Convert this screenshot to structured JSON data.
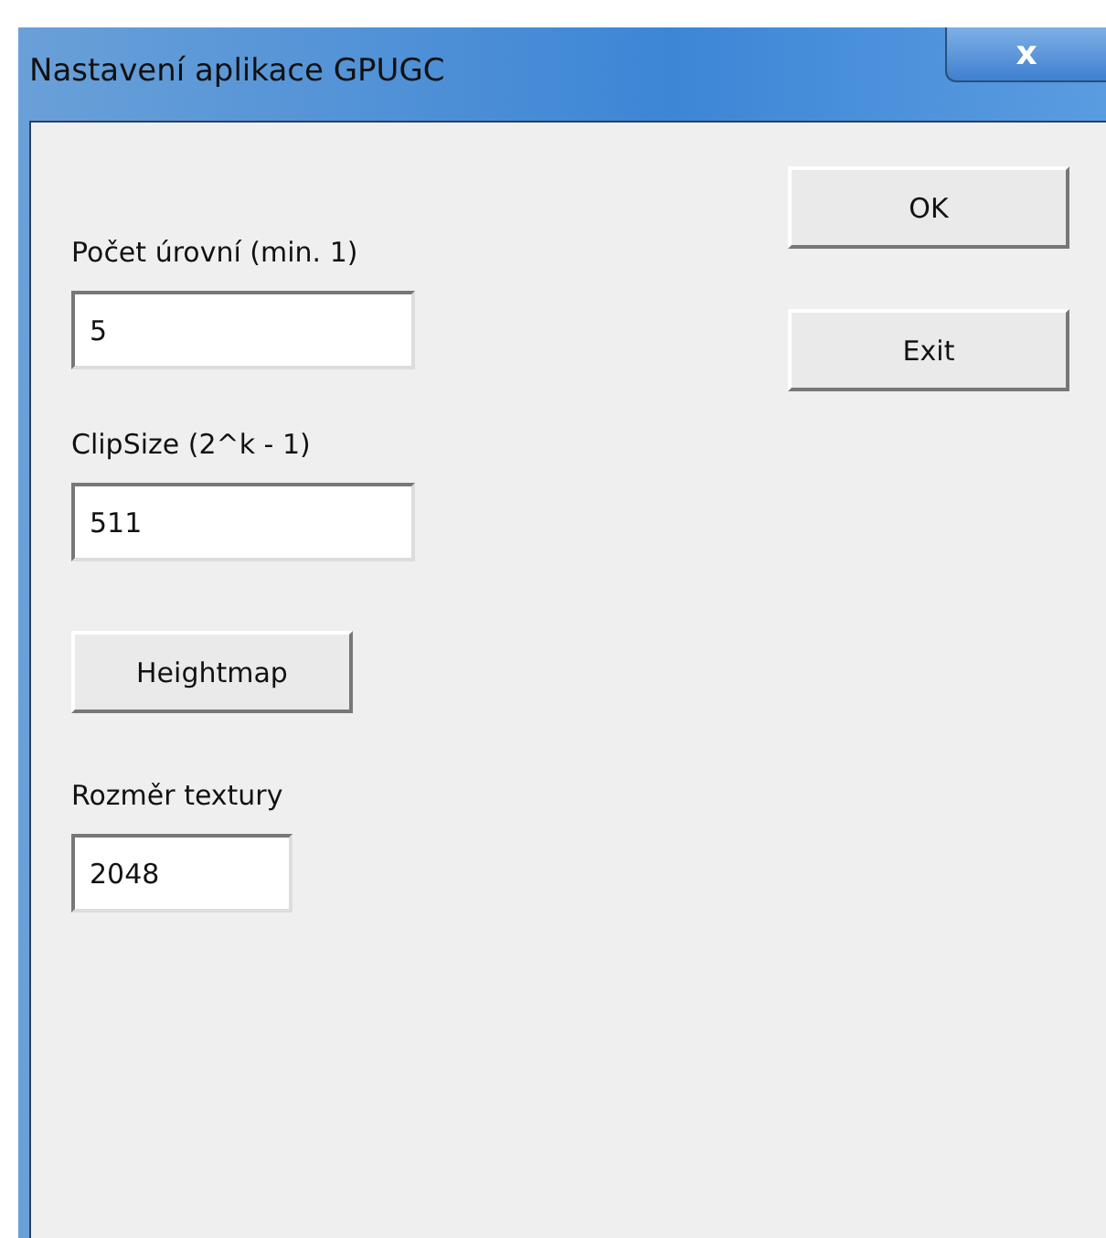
{
  "window": {
    "title": "Nastavení aplikace GPUGC",
    "close": "x"
  },
  "form": [
    {
      "kind": "field",
      "label": "Počet úrovní (min. 1)",
      "value": "5"
    },
    {
      "kind": "field",
      "label": "ClipSize (2^k - 1)",
      "value": "511"
    },
    {
      "kind": "button",
      "label": "Heightmap"
    },
    {
      "kind": "short-field",
      "label": "Rozměr textury",
      "value": "2048"
    }
  ],
  "buttons": [
    "OK",
    "Exit"
  ]
}
